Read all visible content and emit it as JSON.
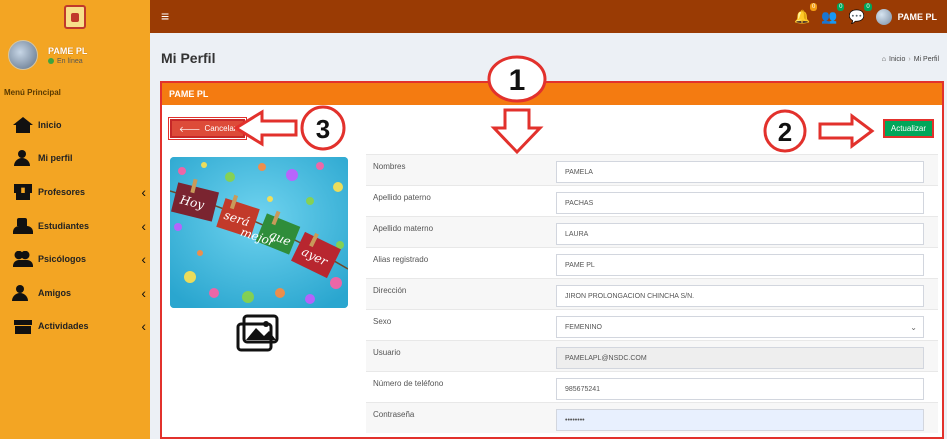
{
  "topbar": {
    "menu_icon": "hamburger-icon",
    "notifications": {
      "icon": "bell-icon",
      "count": "0"
    },
    "friend_requests": {
      "icon": "user-plus-icon",
      "count": "0"
    },
    "messages": {
      "icon": "comment-icon",
      "count": "0"
    },
    "user_name": "PAME PL"
  },
  "sidebar": {
    "user_name": "PAME PL",
    "user_status": "En línea",
    "menu_header": "Menú Principal",
    "items": [
      {
        "label": "Inicio",
        "icon": "home-icon"
      },
      {
        "label": "Mi perfil",
        "icon": "user-icon"
      },
      {
        "label": "Profesores",
        "icon": "teacher-icon",
        "chevron": "‹"
      },
      {
        "label": "Estudiantes",
        "icon": "students-icon",
        "chevron": "‹"
      },
      {
        "label": "Psicólogos",
        "icon": "psychologist-icon",
        "chevron": "‹"
      },
      {
        "label": "Amigos",
        "icon": "friends-icon",
        "chevron": "‹"
      },
      {
        "label": "Actividades",
        "icon": "gift-icon",
        "chevron": "‹"
      }
    ]
  },
  "page": {
    "title": "Mi Perfil",
    "breadcrumb": {
      "home": "Inicio",
      "current": "Mi Perfil"
    }
  },
  "panel": {
    "header": "PAME PL",
    "cancel_label": "Cancelar",
    "update_label": "Actualizar",
    "image_text": [
      "Hoy",
      "será",
      "mejor",
      "que",
      "ayer"
    ]
  },
  "form": {
    "fields": [
      {
        "label": "Nombres",
        "value": "PAMELA"
      },
      {
        "label": "Apellido paterno",
        "value": "PACHAS"
      },
      {
        "label": "Apellido materno",
        "value": "LAURA"
      },
      {
        "label": "Alias registrado",
        "value": "PAME PL"
      },
      {
        "label": "Dirección",
        "value": "JIRON PROLONGACION CHINCHA S/N."
      },
      {
        "label": "Sexo",
        "value": "FEMENINO"
      },
      {
        "label": "Usuario",
        "value": "PAMELAPL@NSDC.COM"
      },
      {
        "label": "Número de teléfono",
        "value": "985675241"
      },
      {
        "label": "Contraseña",
        "value": "••••••••"
      }
    ]
  },
  "annotations": {
    "one": "1",
    "two": "2",
    "three": "3"
  },
  "colors": {
    "topbar": "#9a3b04",
    "sidebar": "#f3a523",
    "panel_header": "#f47b11",
    "annotation_red": "#e2312c",
    "update_button": "#00a65a",
    "cancel_button": "#dd4b39"
  }
}
